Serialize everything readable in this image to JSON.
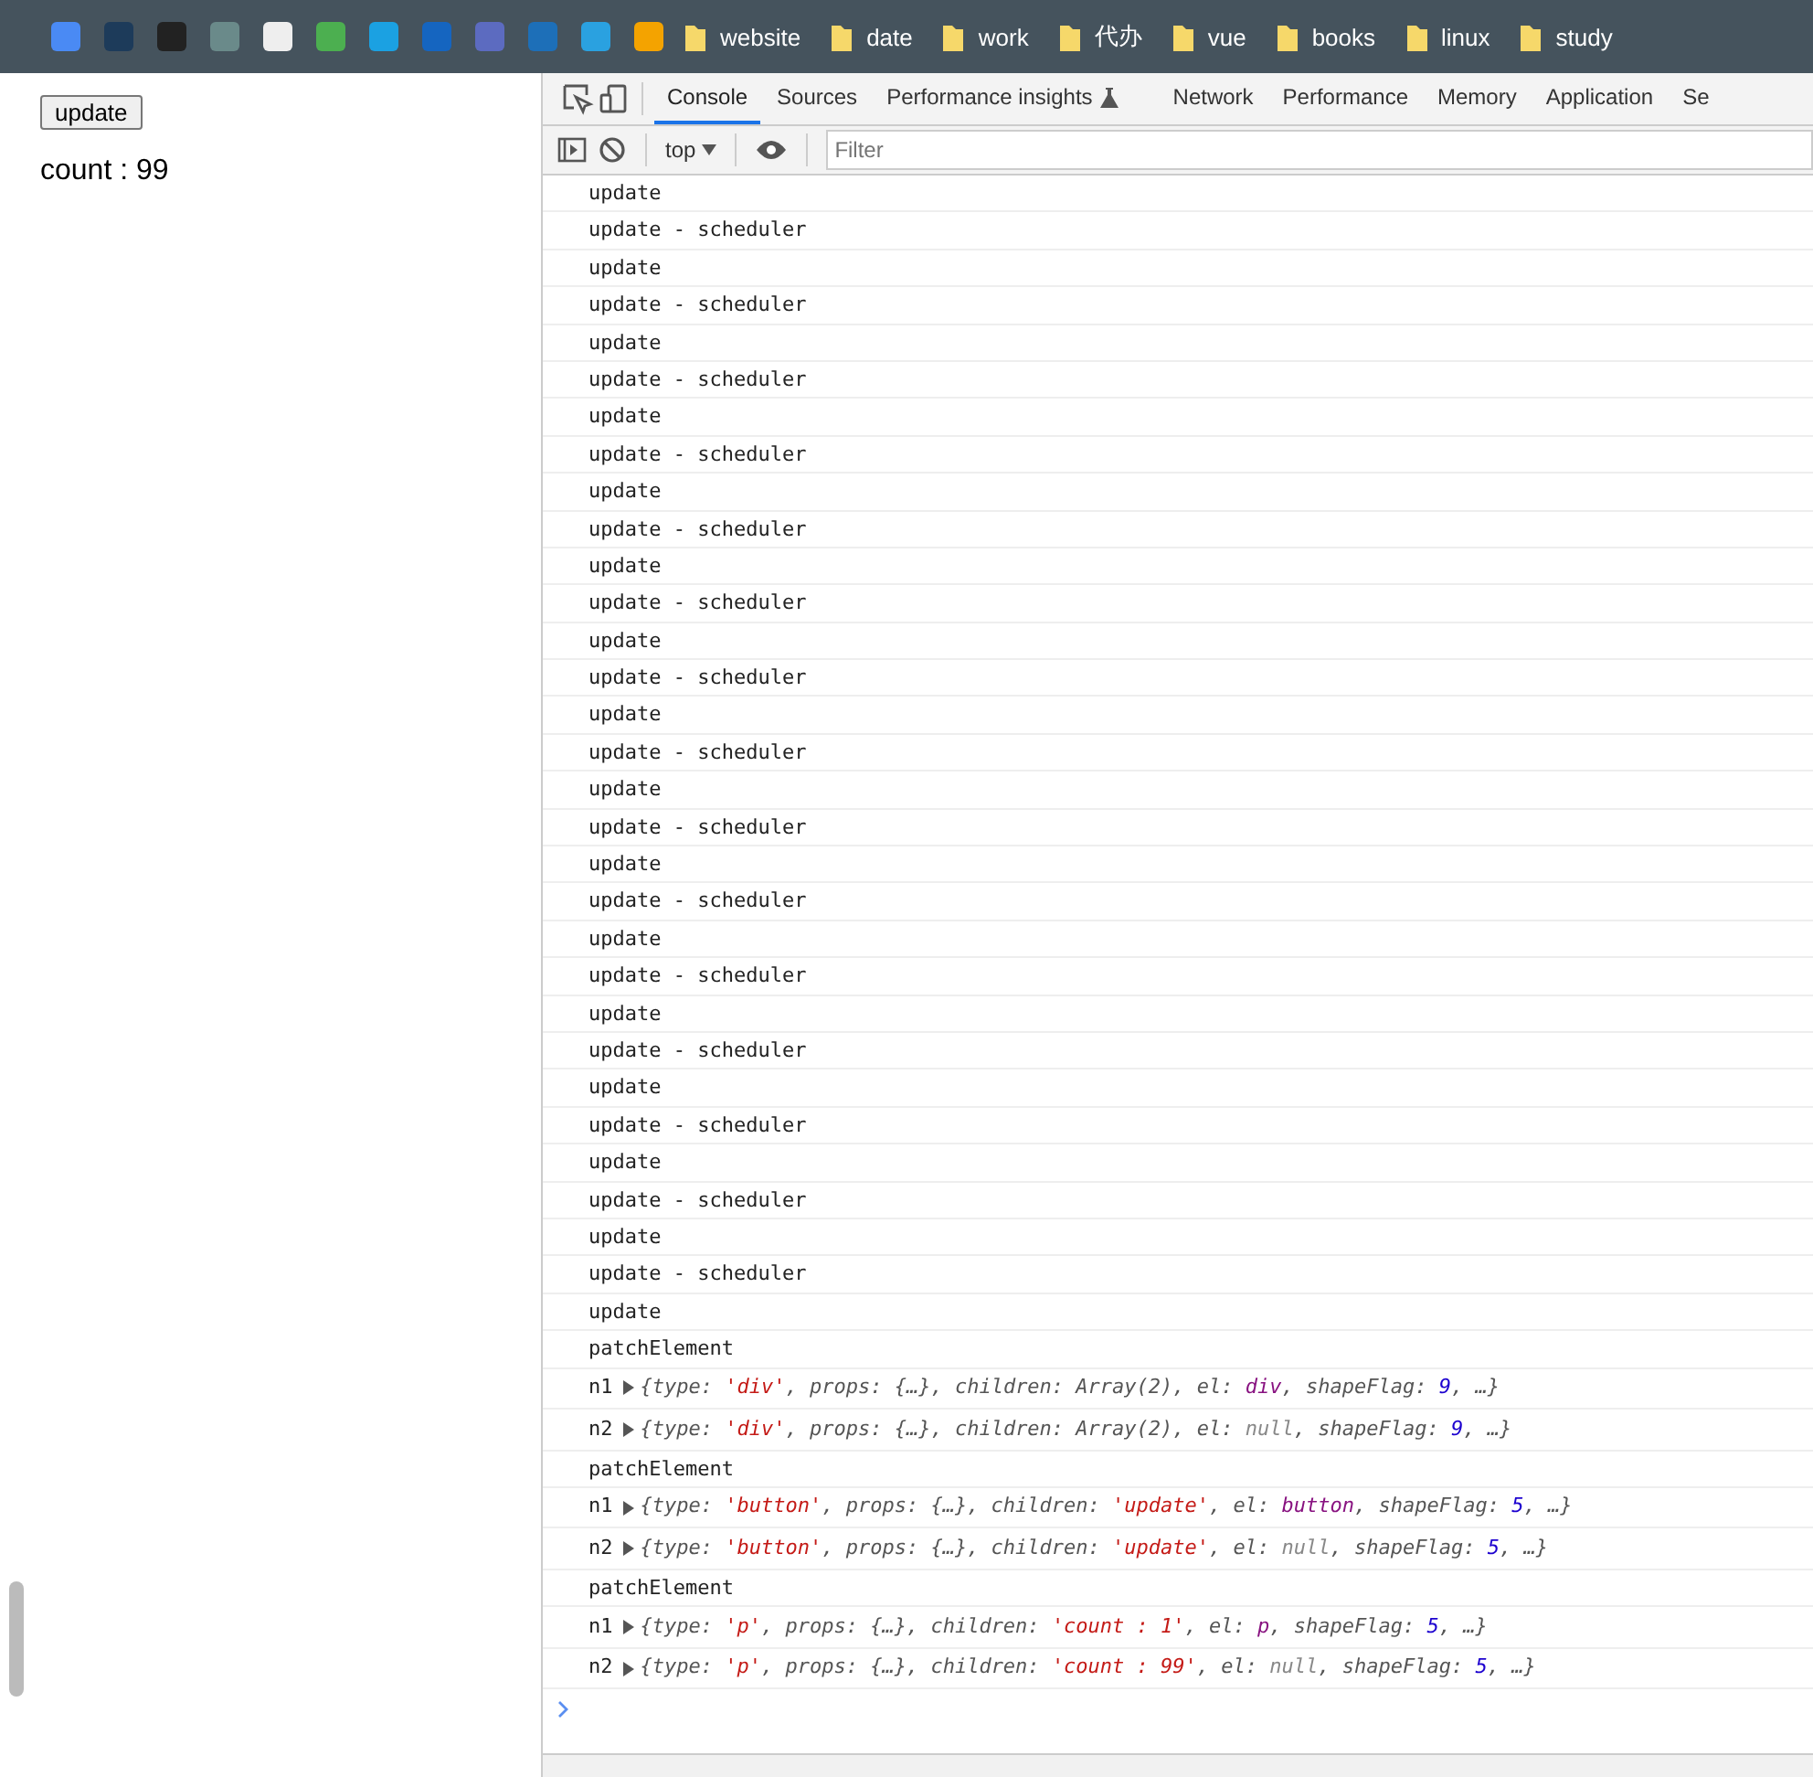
{
  "bookmarks": [
    {
      "label": "website"
    },
    {
      "label": "date"
    },
    {
      "label": "work"
    },
    {
      "label": "代办"
    },
    {
      "label": "vue"
    },
    {
      "label": "books"
    },
    {
      "label": "linux"
    },
    {
      "label": "study"
    }
  ],
  "page": {
    "button": "update",
    "count_text": "count : 99"
  },
  "devtools": {
    "tabs": [
      {
        "label": "Console",
        "selected": true
      },
      {
        "label": "Sources",
        "selected": false
      },
      {
        "label": "Performance insights",
        "selected": false,
        "flask": true
      },
      {
        "label": "Network",
        "selected": false
      },
      {
        "label": "Performance",
        "selected": false
      },
      {
        "label": "Memory",
        "selected": false
      },
      {
        "label": "Application",
        "selected": false
      },
      {
        "label": "Se",
        "selected": false
      }
    ],
    "context": "top",
    "filter_placeholder": "Filter",
    "logs": [
      {
        "kind": "text",
        "text": "update"
      },
      {
        "kind": "text",
        "text": "update - scheduler"
      },
      {
        "kind": "text",
        "text": "update"
      },
      {
        "kind": "text",
        "text": "update - scheduler"
      },
      {
        "kind": "text",
        "text": "update"
      },
      {
        "kind": "text",
        "text": "update - scheduler"
      },
      {
        "kind": "text",
        "text": "update"
      },
      {
        "kind": "text",
        "text": "update - scheduler"
      },
      {
        "kind": "text",
        "text": "update"
      },
      {
        "kind": "text",
        "text": "update - scheduler"
      },
      {
        "kind": "text",
        "text": "update"
      },
      {
        "kind": "text",
        "text": "update - scheduler"
      },
      {
        "kind": "text",
        "text": "update"
      },
      {
        "kind": "text",
        "text": "update - scheduler"
      },
      {
        "kind": "text",
        "text": "update"
      },
      {
        "kind": "text",
        "text": "update - scheduler"
      },
      {
        "kind": "text",
        "text": "update"
      },
      {
        "kind": "text",
        "text": "update - scheduler"
      },
      {
        "kind": "text",
        "text": "update"
      },
      {
        "kind": "text",
        "text": "update - scheduler"
      },
      {
        "kind": "text",
        "text": "update"
      },
      {
        "kind": "text",
        "text": "update - scheduler"
      },
      {
        "kind": "text",
        "text": "update"
      },
      {
        "kind": "text",
        "text": "update - scheduler"
      },
      {
        "kind": "text",
        "text": "update"
      },
      {
        "kind": "text",
        "text": "update - scheduler"
      },
      {
        "kind": "text",
        "text": "update"
      },
      {
        "kind": "text",
        "text": "update - scheduler"
      },
      {
        "kind": "text",
        "text": "update"
      },
      {
        "kind": "text",
        "text": "update - scheduler"
      },
      {
        "kind": "text",
        "text": "update"
      },
      {
        "kind": "text",
        "text": "patchElement"
      },
      {
        "kind": "object",
        "label": "n1",
        "parts": [
          {
            "kind": "plain",
            "text": "{type: "
          },
          {
            "kind": "string",
            "text": "'div'"
          },
          {
            "kind": "plain",
            "text": ", props: {…}, children: Array(2), el: "
          },
          {
            "kind": "node",
            "text": "div"
          },
          {
            "kind": "plain",
            "text": ", shapeFlag: "
          },
          {
            "kind": "number",
            "text": "9"
          },
          {
            "kind": "plain",
            "text": ", …}"
          }
        ]
      },
      {
        "kind": "object",
        "label": "n2",
        "parts": [
          {
            "kind": "plain",
            "text": "{type: "
          },
          {
            "kind": "string",
            "text": "'div'"
          },
          {
            "kind": "plain",
            "text": ", props: {…}, children: Array(2), el: "
          },
          {
            "kind": "null",
            "text": "null"
          },
          {
            "kind": "plain",
            "text": ", shapeFlag: "
          },
          {
            "kind": "number",
            "text": "9"
          },
          {
            "kind": "plain",
            "text": ", …}"
          }
        ]
      },
      {
        "kind": "text",
        "text": "patchElement"
      },
      {
        "kind": "object",
        "label": "n1",
        "parts": [
          {
            "kind": "plain",
            "text": "{type: "
          },
          {
            "kind": "string",
            "text": "'button'"
          },
          {
            "kind": "plain",
            "text": ", props: {…}, children: "
          },
          {
            "kind": "string",
            "text": "'update'"
          },
          {
            "kind": "plain",
            "text": ", el: "
          },
          {
            "kind": "node",
            "text": "button"
          },
          {
            "kind": "plain",
            "text": ", shapeFlag: "
          },
          {
            "kind": "number",
            "text": "5"
          },
          {
            "kind": "plain",
            "text": ", …}"
          }
        ]
      },
      {
        "kind": "object",
        "label": "n2",
        "parts": [
          {
            "kind": "plain",
            "text": "{type: "
          },
          {
            "kind": "string",
            "text": "'button'"
          },
          {
            "kind": "plain",
            "text": ", props: {…}, children: "
          },
          {
            "kind": "string",
            "text": "'update'"
          },
          {
            "kind": "plain",
            "text": ", el: "
          },
          {
            "kind": "null",
            "text": "null"
          },
          {
            "kind": "plain",
            "text": ", shapeFlag: "
          },
          {
            "kind": "number",
            "text": "5"
          },
          {
            "kind": "plain",
            "text": ", …}"
          }
        ]
      },
      {
        "kind": "text",
        "text": "patchElement"
      },
      {
        "kind": "object",
        "label": "n1",
        "parts": [
          {
            "kind": "plain",
            "text": "{type: "
          },
          {
            "kind": "string",
            "text": "'p'"
          },
          {
            "kind": "plain",
            "text": ", props: {…}, children: "
          },
          {
            "kind": "string",
            "text": "'count : 1'"
          },
          {
            "kind": "plain",
            "text": ", el: "
          },
          {
            "kind": "node",
            "text": "p"
          },
          {
            "kind": "plain",
            "text": ", shapeFlag: "
          },
          {
            "kind": "number",
            "text": "5"
          },
          {
            "kind": "plain",
            "text": ", …}"
          }
        ]
      },
      {
        "kind": "object",
        "label": "n2",
        "parts": [
          {
            "kind": "plain",
            "text": "{type: "
          },
          {
            "kind": "string",
            "text": "'p'"
          },
          {
            "kind": "plain",
            "text": ", props: {…}, children: "
          },
          {
            "kind": "string",
            "text": "'count : 99'"
          },
          {
            "kind": "plain",
            "text": ", el: "
          },
          {
            "kind": "null",
            "text": "null"
          },
          {
            "kind": "plain",
            "text": ", shapeFlag: "
          },
          {
            "kind": "number",
            "text": "5"
          },
          {
            "kind": "plain",
            "text": ", …}"
          }
        ]
      }
    ]
  }
}
